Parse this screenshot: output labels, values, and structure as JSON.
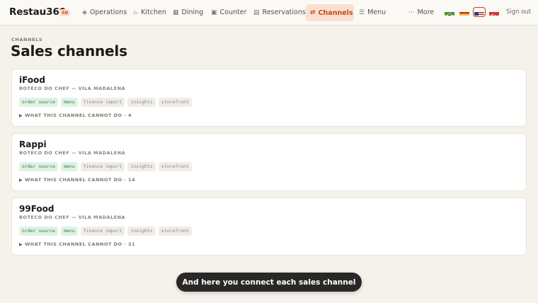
{
  "app": {
    "brand": "Restau360",
    "badge": "8B"
  },
  "nav": {
    "items": [
      {
        "icon": "diamond-icon",
        "glyph": "◈",
        "label": "Operations"
      },
      {
        "icon": "flame-icon",
        "glyph": "♨",
        "label": "Kitchen"
      },
      {
        "icon": "grid-icon",
        "glyph": "▦",
        "label": "Dining"
      },
      {
        "icon": "register-icon",
        "glyph": "▣",
        "label": "Counter"
      },
      {
        "icon": "calendar-icon",
        "glyph": "▤",
        "label": "Reservations"
      },
      {
        "icon": "swap-icon",
        "glyph": "⇄",
        "label": "Channels"
      },
      {
        "icon": "menu-icon",
        "glyph": "☰",
        "label": "Menu"
      },
      {
        "icon": "ellipsis-icon",
        "glyph": "···",
        "label": "More"
      }
    ],
    "active": "Channels",
    "sign_out": "Sign out"
  },
  "languages": [
    "pt-BR",
    "es",
    "en-US",
    "tr"
  ],
  "selected_language": "en-US",
  "page": {
    "breadcrumb": "CHANNELS",
    "title": "Sales channels"
  },
  "channels": [
    {
      "name": "iFood",
      "venue": "BOTECO DO CHEF — VILA MADALENA",
      "capabilities": [
        {
          "label": "order source",
          "enabled": true
        },
        {
          "label": "menu",
          "enabled": true
        },
        {
          "label": "finance import",
          "enabled": false
        },
        {
          "label": "insights",
          "enabled": false
        },
        {
          "label": "storefront",
          "enabled": false
        }
      ],
      "cannot_do": "WHAT THIS CHANNEL CANNOT DO · 4"
    },
    {
      "name": "Rappi",
      "venue": "BOTECO DO CHEF — VILA MADALENA",
      "capabilities": [
        {
          "label": "order source",
          "enabled": true
        },
        {
          "label": "menu",
          "enabled": true
        },
        {
          "label": "finance import",
          "enabled": false
        },
        {
          "label": "insights",
          "enabled": false
        },
        {
          "label": "storefront",
          "enabled": false
        }
      ],
      "cannot_do": "WHAT THIS CHANNEL CANNOT DO · 14"
    },
    {
      "name": "99Food",
      "venue": "BOTECO DO CHEF — VILA MADALENA",
      "capabilities": [
        {
          "label": "order source",
          "enabled": true
        },
        {
          "label": "menu",
          "enabled": true
        },
        {
          "label": "finance import",
          "enabled": false
        },
        {
          "label": "insights",
          "enabled": false
        },
        {
          "label": "storefront",
          "enabled": false
        }
      ],
      "cannot_do": "WHAT THIS CHANNEL CANNOT DO · 21"
    }
  ],
  "toast": "And here you connect each sales channel",
  "colors": {
    "accent": "#c4481c",
    "accent_bg": "#fae0d1",
    "enabled_tag": "#2e7d47",
    "page_bg": "#f5f2ec"
  }
}
